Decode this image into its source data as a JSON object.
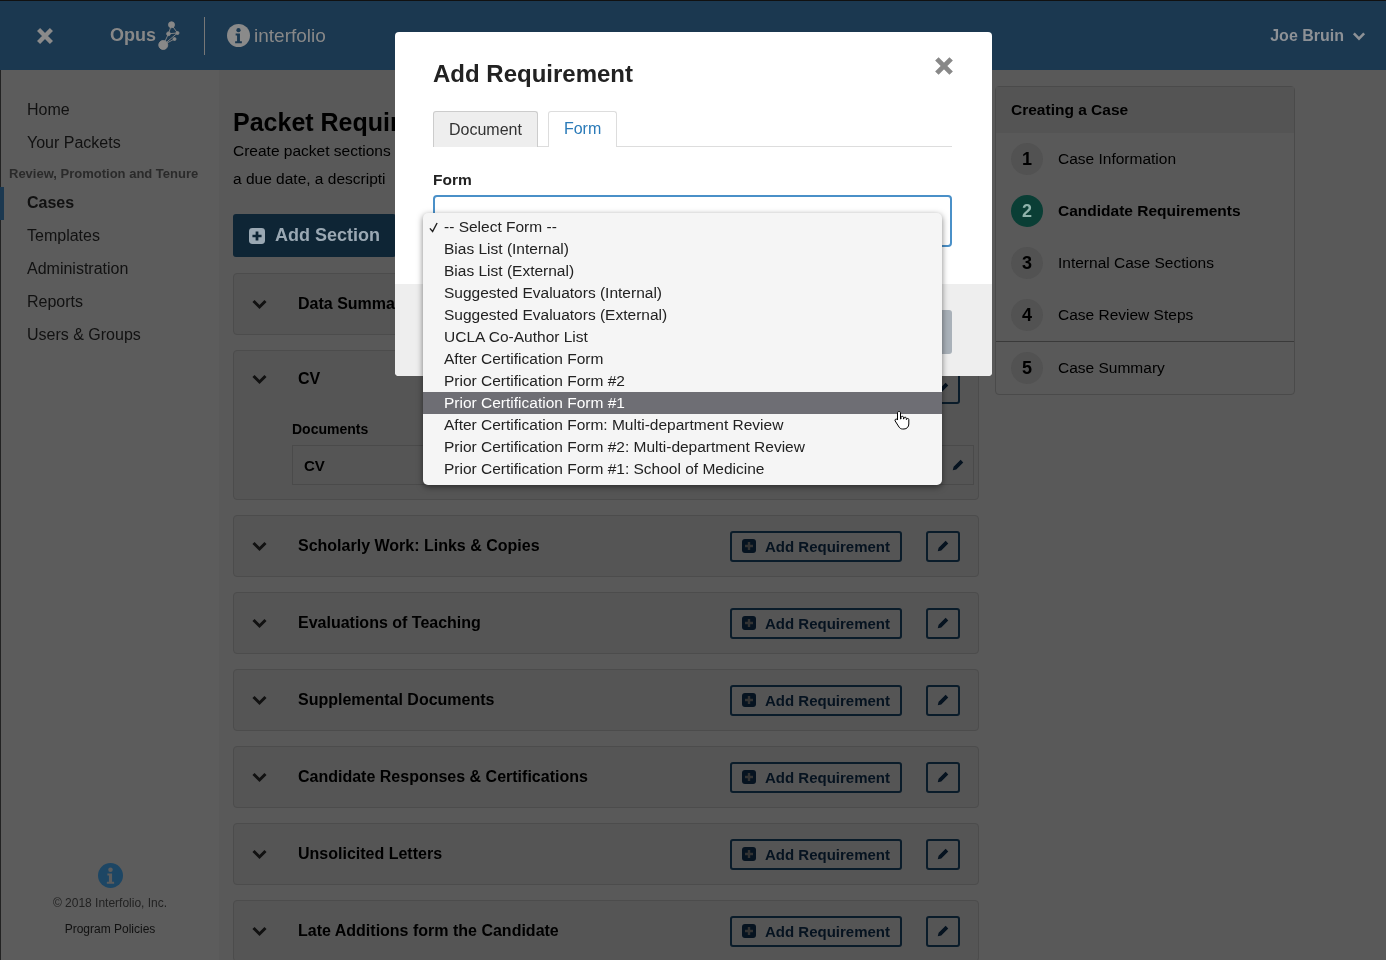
{
  "header": {
    "brand": "Opus",
    "partner": "interfolio",
    "user": "Joe Bruin"
  },
  "sidebar": {
    "items": [
      {
        "label": "Home",
        "kind": "link",
        "selected": false
      },
      {
        "label": "Your Packets",
        "kind": "link",
        "selected": false
      },
      {
        "label": "Review, Promotion and Tenure",
        "kind": "group"
      },
      {
        "label": "Cases",
        "kind": "link",
        "selected": true
      },
      {
        "label": "Templates",
        "kind": "link",
        "selected": false
      },
      {
        "label": "Administration",
        "kind": "link",
        "selected": false
      },
      {
        "label": "Reports",
        "kind": "link",
        "selected": false
      },
      {
        "label": "Users & Groups",
        "kind": "link",
        "selected": false
      }
    ],
    "copyright": "© 2018 Interfolio, Inc.",
    "policies": "Program Policies"
  },
  "page": {
    "title": "Packet Requir",
    "description": [
      "Create packet sections",
      "a due date, a descripti"
    ],
    "add_button": "Add Section"
  },
  "sections": [
    {
      "title": "Data Summa",
      "expanded": false
    },
    {
      "title": "CV",
      "expanded": true,
      "edit": true,
      "documents_label": "Documents",
      "documents": [
        "CV"
      ]
    },
    {
      "title": "Scholarly Work: Links & Copies",
      "expanded": false,
      "button": "Add Requirement",
      "edit": true
    },
    {
      "title": "Evaluations of Teaching",
      "expanded": false,
      "button": "Add Requirement",
      "edit": true
    },
    {
      "title": "Supplemental Documents",
      "expanded": false,
      "button": "Add Requirement",
      "edit": true
    },
    {
      "title": "Candidate Responses & Certifications",
      "expanded": false,
      "button": "Add Requirement",
      "edit": true
    },
    {
      "title": "Unsolicited Letters",
      "expanded": false,
      "button": "Add Requirement",
      "edit": true
    },
    {
      "title": "Late Additions form the Candidate",
      "expanded": false,
      "button": "Add Requirement",
      "edit": true
    }
  ],
  "steps_panel": {
    "title": "Creating a Case",
    "steps": [
      {
        "number": "1",
        "label": "Case Information",
        "selected": false
      },
      {
        "number": "2",
        "label": "Candidate Requirements",
        "selected": true
      },
      {
        "number": "3",
        "label": "Internal Case Sections",
        "selected": false
      },
      {
        "number": "4",
        "label": "Case Review Steps",
        "selected": false
      },
      {
        "number": "5",
        "label": "Case Summary",
        "selected": false
      }
    ]
  },
  "modal": {
    "title": "Add Requirement",
    "tabs": [
      {
        "label": "Document",
        "selected": false
      },
      {
        "label": "Form",
        "selected": true
      }
    ],
    "field_label": "Form",
    "options": [
      {
        "label": "-- Select Form --",
        "checked": true,
        "hovered": false
      },
      {
        "label": "Bias List (Internal)",
        "checked": false,
        "hovered": false
      },
      {
        "label": "Bias List (External)",
        "checked": false,
        "hovered": false
      },
      {
        "label": "Suggested Evaluators (Internal)",
        "checked": false,
        "hovered": false
      },
      {
        "label": "Suggested Evaluators (External)",
        "checked": false,
        "hovered": false
      },
      {
        "label": "UCLA Co-Author List",
        "checked": false,
        "hovered": false
      },
      {
        "label": "After Certification Form",
        "checked": false,
        "hovered": false
      },
      {
        "label": "Prior Certification Form #2",
        "checked": false,
        "hovered": false
      },
      {
        "label": "Prior Certification Form #1",
        "checked": false,
        "hovered": true
      },
      {
        "label": "After Certification Form: Multi-department Review",
        "checked": false,
        "hovered": false
      },
      {
        "label": "Prior Certification Form #2: Multi-department Review",
        "checked": false,
        "hovered": false
      },
      {
        "label": "Prior Certification Form #1: School of Medicine",
        "checked": false,
        "hovered": false
      }
    ]
  }
}
